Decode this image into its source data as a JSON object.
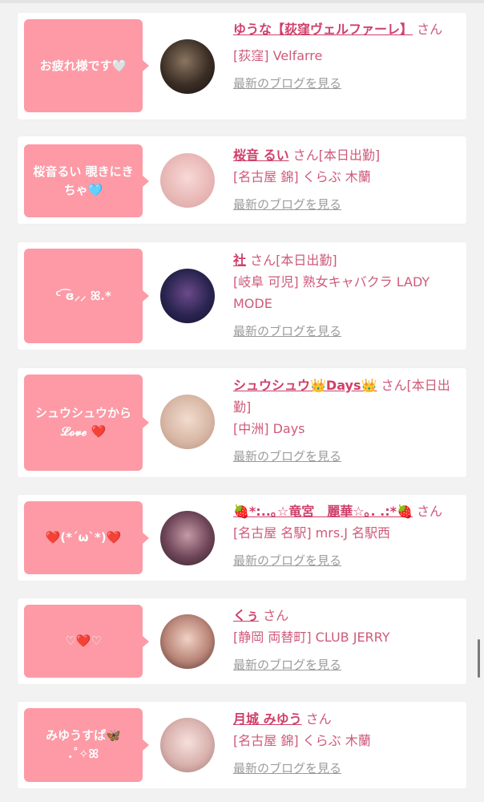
{
  "theme": {
    "bubble_color": "#fd9aa6",
    "name_color": "#cf3f6a",
    "text_color": "#cf5a7a",
    "link_color": "#9b9b9b"
  },
  "entries": [
    {
      "bubble": "お疲れ様です🤍",
      "name": "ゆうな【荻窪ヴェルファーレ】",
      "suffix": " さん",
      "shop": "[荻窪] Velfarre",
      "blog_link": "最新のブログを見る",
      "avatar_icon": "avatar-photo"
    },
    {
      "bubble": "桜音るい 覗きにきちゃ🩵",
      "name": "桜音 るい",
      "suffix": " さん[本日出勤]",
      "shop": "[名古屋 錦] くらぶ 木蘭",
      "blog_link": "最新のブログを見る",
      "avatar_icon": "avatar-photo"
    },
    {
      "bubble": "ᑦ ͡ɞ⸝⸝ ꕤ.*",
      "name": "社",
      "suffix": " さん[本日出勤]",
      "shop": "[岐阜 可児] 熟女キャバクラ LADY MODE",
      "blog_link": "最新のブログを見る",
      "avatar_icon": "avatar-photo"
    },
    {
      "bubble": "シュウシュウから 𝓛𝓸𝓿𝓮 ❤️",
      "name": "シュウシュウ👑Days👑",
      "suffix": " さん[本日出勤]",
      "shop": "[中洲] Days",
      "blog_link": "最新のブログを見る",
      "avatar_icon": "avatar-photo"
    },
    {
      "bubble": "❤️(*´ω`*)❤️",
      "name": "🍓*:..｡☆竜宮　麗華☆｡. .:*🍓",
      "suffix": " さん",
      "shop": "[名古屋 名駅] mrs.J 名駅西",
      "blog_link": "最新のブログを見る",
      "avatar_icon": "avatar-photo"
    },
    {
      "bubble": "♡❤️♡",
      "name": "くぅ",
      "suffix": " さん",
      "shop": "[静岡 両替町] CLUB JERRY",
      "blog_link": "最新のブログを見る",
      "avatar_icon": "avatar-photo"
    },
    {
      "bubble": "みゆうすぱ🦋 .˚✧ꕤ",
      "name": "月城 みゆう",
      "suffix": " さん",
      "shop": "[名古屋 錦] くらぶ 木蘭",
      "blog_link": "最新のブログを見る",
      "avatar_icon": "avatar-photo"
    }
  ]
}
